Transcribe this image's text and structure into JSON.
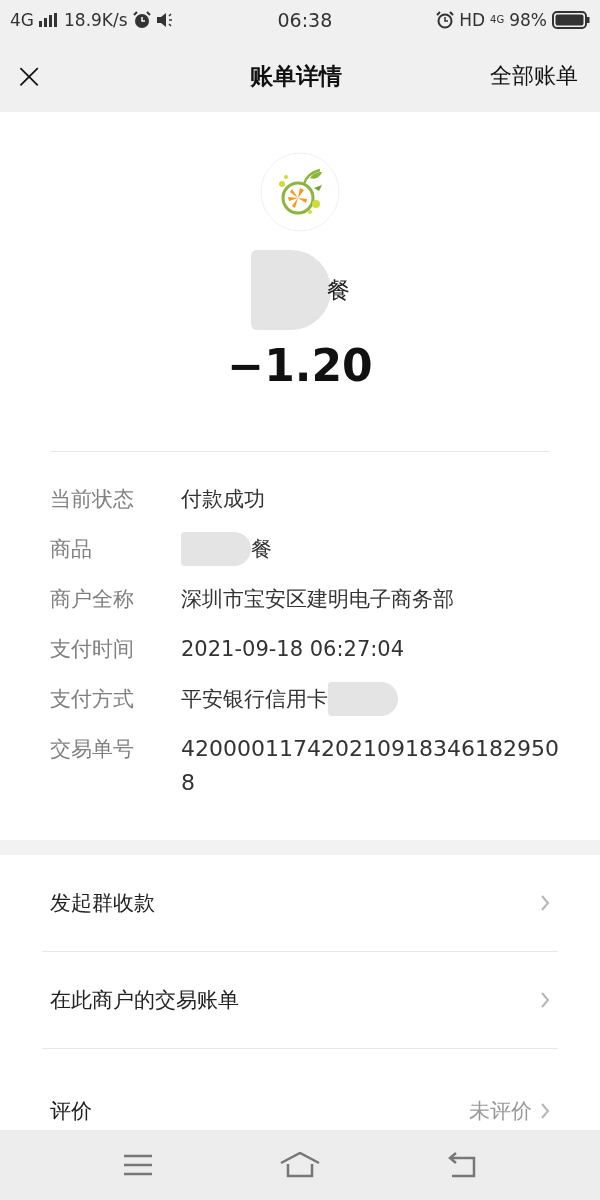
{
  "status_bar": {
    "network": "4G",
    "speed": "18.9K/s",
    "time": "06:38",
    "hd": "HD",
    "hd_network": "4G",
    "battery": "98%"
  },
  "nav": {
    "close": "×",
    "title": "账单详情",
    "action": "全部账单"
  },
  "merchant": {
    "name": "餐",
    "amount": "−1.20"
  },
  "details": [
    {
      "label": "当前状态",
      "value": "付款成功",
      "redacted": false
    },
    {
      "label": "商品",
      "value": "餐",
      "redacted": true
    },
    {
      "label": "商户全称",
      "value": "深圳市宝安区建明电子商务部",
      "redacted": false
    },
    {
      "label": "支付时间",
      "value": "2021-09-18 06:27:04",
      "redacted": false
    },
    {
      "label": "支付方式",
      "value": "平安银行信用卡",
      "redacted": true
    },
    {
      "label": "交易单号",
      "value": "4200001174202109183461829508",
      "redacted": false
    }
  ],
  "actions": [
    {
      "label": "发起群收款"
    },
    {
      "label": "在此商户的交易账单"
    },
    {
      "label": "评价",
      "value": "未评价"
    }
  ]
}
